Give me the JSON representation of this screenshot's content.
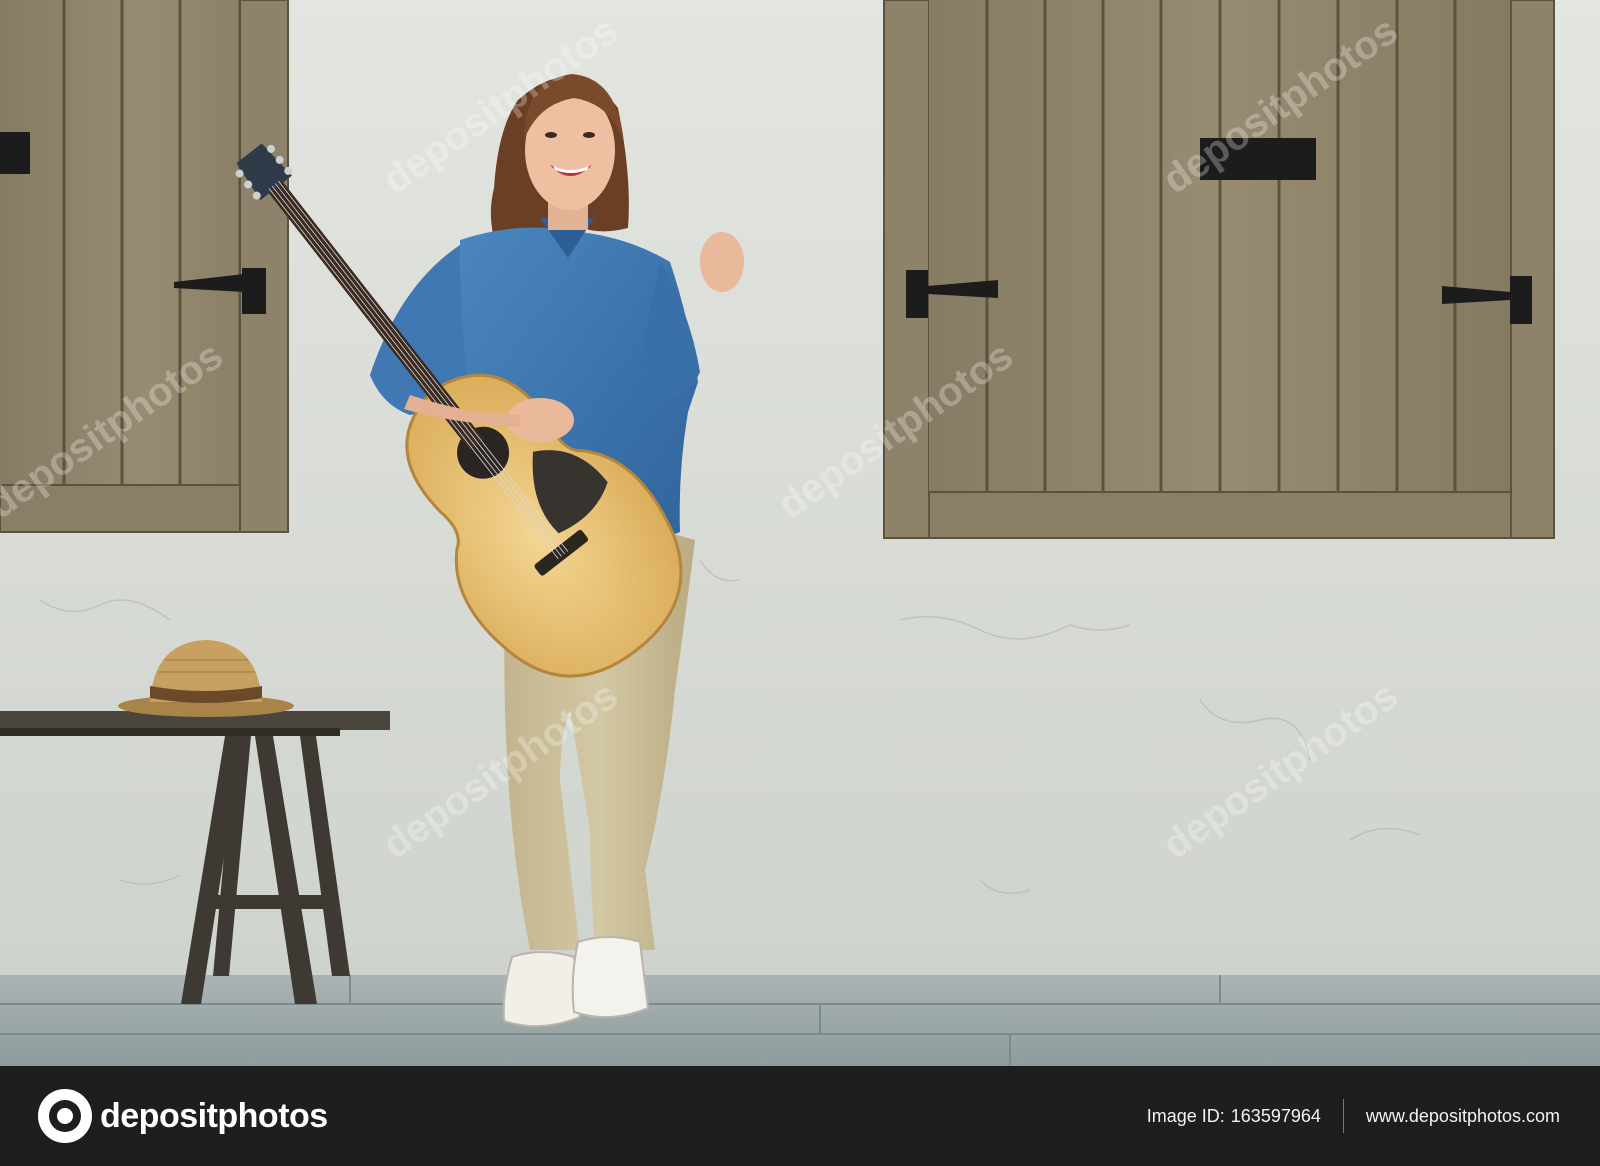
{
  "photo": {
    "scene": [
      "wall",
      "wooden-shutters",
      "woman",
      "acoustic-guitar",
      "bench",
      "straw-hat",
      "wooden-floor"
    ],
    "colors": {
      "wall": "#d9dcd6",
      "shutter_wood": "#8c8168",
      "shirt_denim": "#3f79b4",
      "pants_khaki": "#cbbf9a",
      "guitar_top": "#e9c47a",
      "floor": "#98a5a6"
    }
  },
  "watermark": {
    "text": "depositphotos"
  },
  "footer": {
    "brand": "depositphotos",
    "image_id_label": "Image ID:",
    "image_id": "163597964",
    "site": "www.depositphotos.com"
  }
}
